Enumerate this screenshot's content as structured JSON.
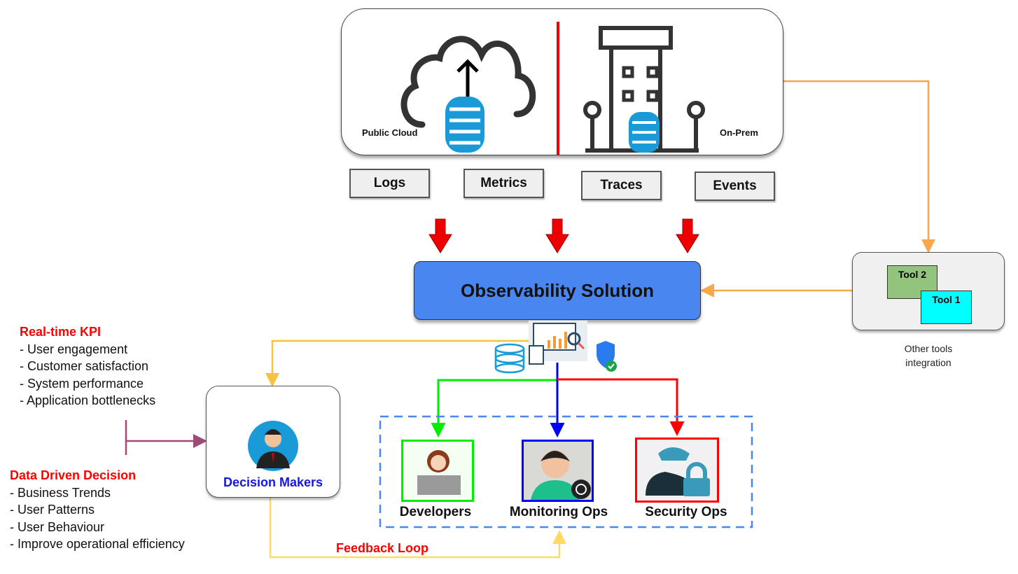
{
  "sources": {
    "public_cloud": "Public Cloud",
    "on_prem": "On-Prem"
  },
  "signals": [
    "Logs",
    "Metrics",
    "Traces",
    "Events"
  ],
  "observability": "Observability Solution",
  "tools": {
    "tool2": "Tool 2",
    "tool1": "Tool 1",
    "caption_line1": "Other tools",
    "caption_line2": "integration"
  },
  "kpi": {
    "title": "Real-time KPI",
    "items": [
      "- User engagement",
      "- Customer satisfaction",
      "- System performance",
      "- Application bottlenecks"
    ]
  },
  "ddd": {
    "title": "Data Driven Decision",
    "items": [
      "- Business Trends",
      "- User Patterns",
      "- User Behaviour",
      "- Improve operational efficiency"
    ]
  },
  "decision_makers": "Decision Makers",
  "teams": [
    "Developers",
    "Monitoring Ops",
    "Security Ops"
  ],
  "feedback": "Feedback Loop",
  "colors": {
    "accent_blue": "#4a86f0",
    "red": "#ff0000",
    "green": "#00ee00",
    "blue": "#0000ff",
    "orange": "#f7a84a",
    "yellow": "#ffd966",
    "db_blue": "#1a9bd7"
  }
}
